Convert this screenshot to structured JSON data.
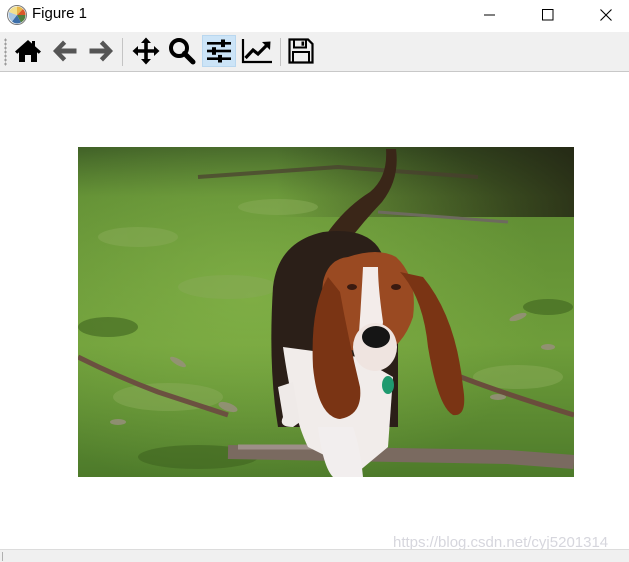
{
  "window": {
    "title": "Figure 1",
    "controls": [
      "minimize",
      "maximize",
      "close"
    ]
  },
  "toolbar": {
    "buttons": [
      {
        "icon": "home-icon",
        "tooltip": "Home"
      },
      {
        "icon": "back-arrow-icon",
        "tooltip": "Back"
      },
      {
        "icon": "forward-arrow-icon",
        "tooltip": "Forward"
      },
      {
        "icon": "pan-icon",
        "tooltip": "Pan"
      },
      {
        "icon": "zoom-icon",
        "tooltip": "Zoom"
      },
      {
        "icon": "subplots-icon",
        "tooltip": "Configure subplots",
        "active": true
      },
      {
        "icon": "edit-axis-icon",
        "tooltip": "Edit axis"
      },
      {
        "icon": "save-icon",
        "tooltip": "Save"
      }
    ]
  },
  "figure": {
    "image_subject": "basset hound walking on grass"
  },
  "watermark": "https://blog.csdn.net/cyj5201314",
  "colors": {
    "toolbar_bg": "#f0f0f0",
    "active_button_bg": "#cce4f7",
    "grass": "#6f9a3a"
  }
}
